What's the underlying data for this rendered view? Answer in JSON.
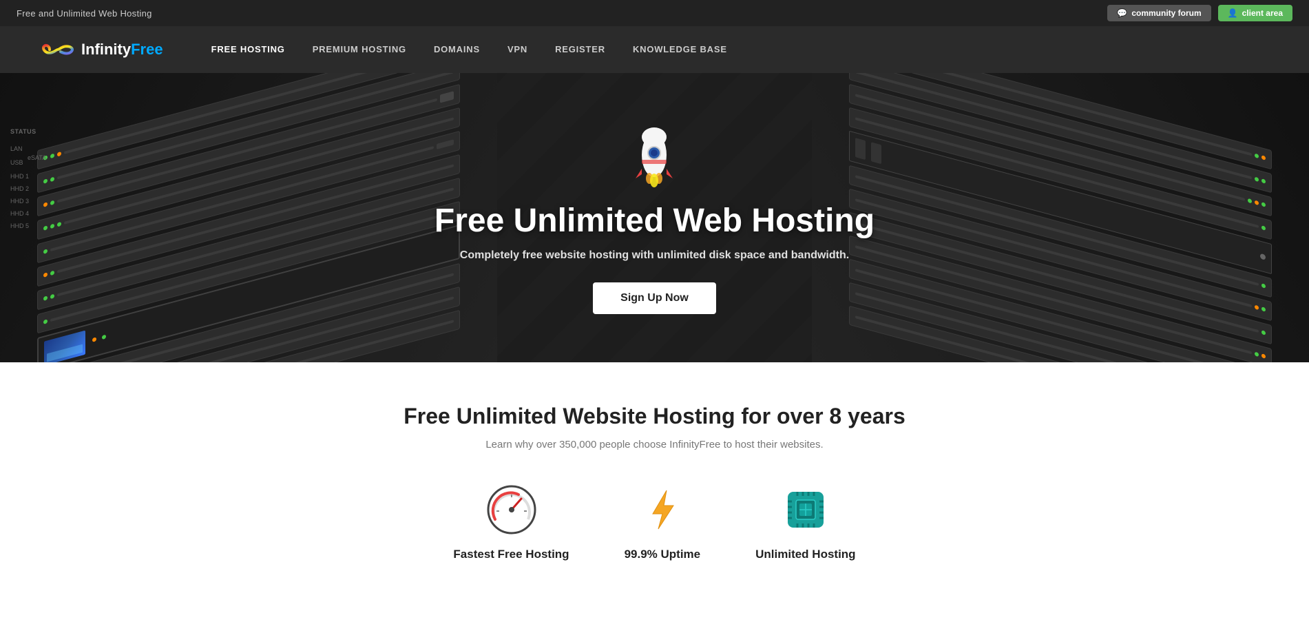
{
  "topBar": {
    "title": "Free and Unlimited Web Hosting",
    "forumBtn": "community forum",
    "clientBtn": "client area"
  },
  "navbar": {
    "brandInfinity": "Infinity",
    "brandFree": "Free",
    "links": [
      {
        "label": "FREE HOSTING",
        "active": true
      },
      {
        "label": "PREMIUM HOSTING",
        "active": false
      },
      {
        "label": "DOMAINS",
        "active": false
      },
      {
        "label": "VPN",
        "active": false
      },
      {
        "label": "REGISTER",
        "active": false
      },
      {
        "label": "KNOWLEDGE BASE",
        "active": false
      }
    ]
  },
  "hero": {
    "title": "Free Unlimited Web Hosting",
    "subtitle": "Completely free website hosting with unlimited disk space and bandwidth.",
    "ctaLabel": "Sign Up Now"
  },
  "features": {
    "sectionTitle": "Free Unlimited Website Hosting for over 8 years",
    "sectionSubtitle": "Learn why over 350,000 people choose InfinityFree to host their websites.",
    "items": [
      {
        "label": "Fastest Free Hosting",
        "icon": "speedometer"
      },
      {
        "label": "99.9% Uptime",
        "icon": "lightning"
      },
      {
        "label": "Unlimited Hosting",
        "icon": "chip"
      }
    ]
  }
}
